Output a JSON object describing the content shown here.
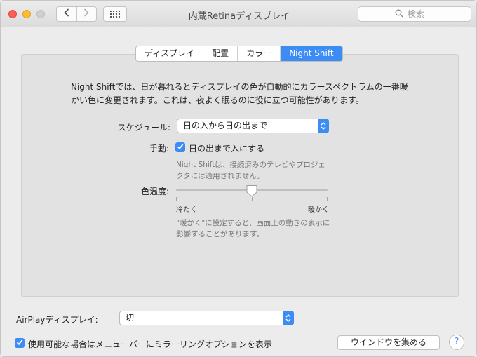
{
  "window": {
    "title": "内蔵Retinaディスプレイ"
  },
  "toolbar": {
    "back_icon": "chevron-left-icon",
    "forward_icon": "chevron-right-icon",
    "grid_icon": "grid-icon",
    "search_placeholder": "検索"
  },
  "tabs": [
    {
      "label": "ディスプレイ",
      "active": false
    },
    {
      "label": "配置",
      "active": false
    },
    {
      "label": "カラー",
      "active": false
    },
    {
      "label": "Night Shift",
      "active": true
    }
  ],
  "night_shift": {
    "description_line1": "Night Shiftでは、日が暮れるとディスプレイの色が自動的にカラースペクトラムの一番暖",
    "description_line2": "かい色に変更されます。これは、夜よく眠るのに役に立つ可能性があります。",
    "schedule_label": "スケジュール:",
    "schedule_value": "日の入から日の出まで",
    "manual_label": "手動:",
    "manual_checkbox_label": "日の出まで入にする",
    "manual_checked": true,
    "note_line1": "Night Shiftは、接続済みのテレビやプロジェ",
    "note_line2": "クタには適用されません。",
    "temperature_label": "色温度:",
    "temperature_value": 0.5,
    "slider_min_label": "冷たく",
    "slider_max_label": "暖かく",
    "warning_line1": "\"暖かく\"に設定すると、画面上の動きの表示に",
    "warning_line2": "影響することがあります。"
  },
  "footer": {
    "airplay_label": "AirPlayディスプレイ:",
    "airplay_value": "切",
    "mirror_checkbox_label": "使用可能な場合はメニューバーにミラーリングオプションを表示",
    "mirror_checked": true,
    "gather_windows_button": "ウインドウを集める",
    "help_label": "?"
  },
  "colors": {
    "accent": "#3c8cf6",
    "close": "#fd5f57",
    "minimize": "#febc2e"
  }
}
